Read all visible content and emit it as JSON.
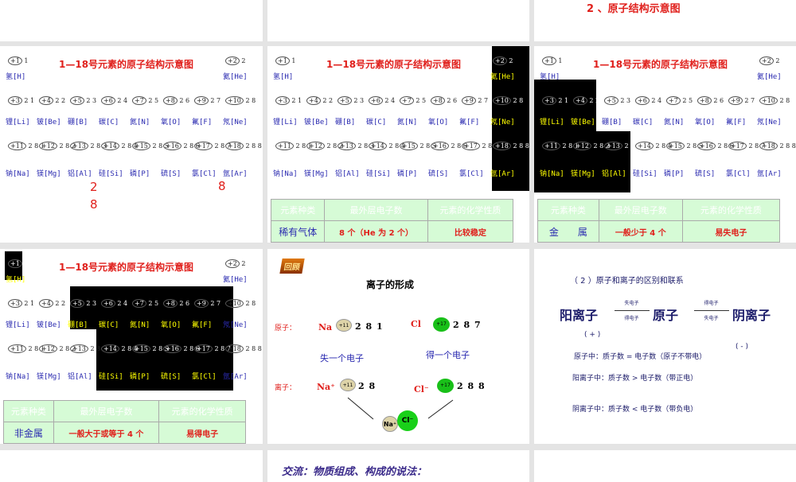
{
  "slide_top_right": {
    "title": "2 、原子结构示意图"
  },
  "diagram_title": "1—18号元素的原子结构示意图",
  "elements": [
    {
      "nuc": "+1",
      "shells": "1",
      "label": "氢[H]"
    },
    {
      "nuc": "+2",
      "shells": "2",
      "label": "氦[He]"
    },
    {
      "nuc": "+3",
      "shells": "2 1",
      "label": "锂[Li]"
    },
    {
      "nuc": "+4",
      "shells": "2 2",
      "label": "铍[Be]"
    },
    {
      "nuc": "+5",
      "shells": "2 3",
      "label": "硼[B]"
    },
    {
      "nuc": "+6",
      "shells": "2 4",
      "label": "碳[C]"
    },
    {
      "nuc": "+7",
      "shells": "2 5",
      "label": "氮[N]"
    },
    {
      "nuc": "+8",
      "shells": "2 6",
      "label": "氧[O]"
    },
    {
      "nuc": "+9",
      "shells": "2 7",
      "label": "氟[F]"
    },
    {
      "nuc": "+10",
      "shells": "2 8",
      "label": "氖[Ne]"
    },
    {
      "nuc": "+11",
      "shells": "2 8 1",
      "label": "钠[Na]"
    },
    {
      "nuc": "+12",
      "shells": "2 8 2",
      "label": "镁[Mg]"
    },
    {
      "nuc": "+13",
      "shells": "2 8 3",
      "label": "铝[Al]"
    },
    {
      "nuc": "+14",
      "shells": "2 8 4",
      "label": "硅[Si]"
    },
    {
      "nuc": "+15",
      "shells": "2 8 5",
      "label": "磷[P]"
    },
    {
      "nuc": "+16",
      "shells": "2 8 6",
      "label": "硫[S]"
    },
    {
      "nuc": "+17",
      "shells": "2 8 7",
      "label": "氯[Cl]"
    },
    {
      "nuc": "+18",
      "shells": "2 8 8",
      "label": "氩[Ar]"
    }
  ],
  "slide1": {
    "annot": [
      "2",
      "8",
      "8"
    ]
  },
  "table_headers": [
    "元素种类",
    "最外层电子数",
    "元素的化学性质"
  ],
  "slide2": {
    "row": [
      "稀有气体",
      "8 个（He 为 2 个）",
      "比较稳定"
    ]
  },
  "slide3": {
    "row": [
      "金　　属",
      "一般少于 4 个",
      "易失电子"
    ]
  },
  "slide4": {
    "row": [
      "非金属",
      "一般大于或等于 4 个",
      "易得电子"
    ]
  },
  "slide5": {
    "badge": "回顾",
    "title": "离子的形成",
    "atom_label": "原子：",
    "ion_label": "离子：",
    "na": "Na",
    "na_nuc": "+11",
    "na_shells": "2 8 1",
    "cl": "Cl",
    "cl_nuc": "+17",
    "cl_shells": "2 8 7",
    "lose": "失一个电子",
    "gain": "得一个电子",
    "na_ion": "Na⁺",
    "na_ion_shells": "2 8",
    "cl_ion": "Cl⁻",
    "cl_ion_shells": "2 8 8",
    "na_ion_small": "Na⁺",
    "cl_ion_small": "Cl⁻"
  },
  "slide6": {
    "heading": "（ 2 ）原子和离子的区别和联系",
    "cation": "阳离子",
    "atom": "原子",
    "anion": "阴离子",
    "arrow1_top": "失电子",
    "arrow1_bottom": "得电子",
    "arrow2_top": "得电子",
    "arrow2_bottom": "失电子",
    "plus": "( + )",
    "minus": "( - )",
    "line1": "原子中：质子数 = 电子数（原子不带电）",
    "line2": "阳离子中：质子数 > 电子数（带正电）",
    "line3": "阴离子中：质子数 < 电子数（带负电）"
  },
  "slide8": {
    "title": "交流：物质组成、构成的说法："
  }
}
